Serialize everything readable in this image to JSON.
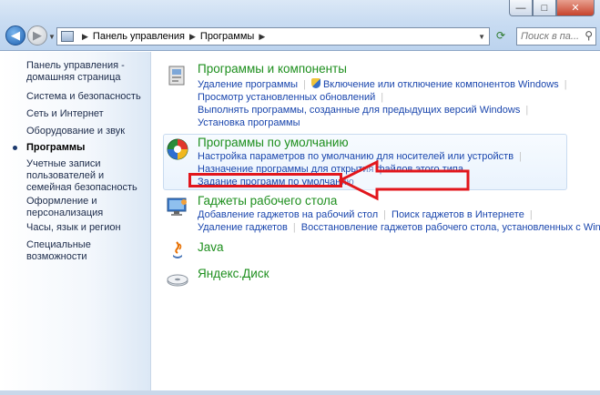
{
  "window": {
    "min_label": "—",
    "max_label": "□",
    "close_label": "✕"
  },
  "nav": {
    "back_icon": "back-arrow",
    "forward_icon": "forward-arrow",
    "breadcrumb": [
      "Панель управления",
      "Программы"
    ],
    "search_placeholder": "Поиск в па..."
  },
  "sidebar": {
    "items": [
      {
        "label": "Панель управления - домашняя страница"
      },
      {
        "label": "Система и безопасность"
      },
      {
        "label": "Сеть и Интернет"
      },
      {
        "label": "Оборудование и звук"
      },
      {
        "label": "Программы",
        "active": true
      },
      {
        "label": "Учетные записи пользователей и семейная безопасность"
      },
      {
        "label": "Оформление и персонализация"
      },
      {
        "label": "Часы, язык и регион"
      },
      {
        "label": "Специальные возможности"
      }
    ]
  },
  "categories": {
    "programs": {
      "title": "Программы и компоненты",
      "links": [
        "Удаление программы",
        "Включение или отключение компонентов Windows",
        "Просмотр установленных обновлений",
        "Выполнять программы, созданные для предыдущих версий Windows",
        "Установка программы"
      ]
    },
    "defaults": {
      "title": "Программы по умолчанию",
      "links": [
        "Настройка параметров по умолчанию для носителей или устройств",
        "Назначение программы для открытия файлов этого типа",
        "Задание программ по умолчанию"
      ]
    },
    "gadgets": {
      "title": "Гаджеты рабочего стола",
      "links": [
        "Добавление гаджетов на рабочий стол",
        "Поиск гаджетов в Интернете",
        "Удаление гаджетов",
        "Восстановление гаджетов рабочего стола, установленных с Windows"
      ]
    },
    "java": {
      "title": "Java"
    },
    "yandex": {
      "title": "Яндекс.Диск"
    }
  },
  "colors": {
    "link": "#1a46ad",
    "category_title": "#1e8f1e",
    "annotation_red": "#e2161c"
  }
}
